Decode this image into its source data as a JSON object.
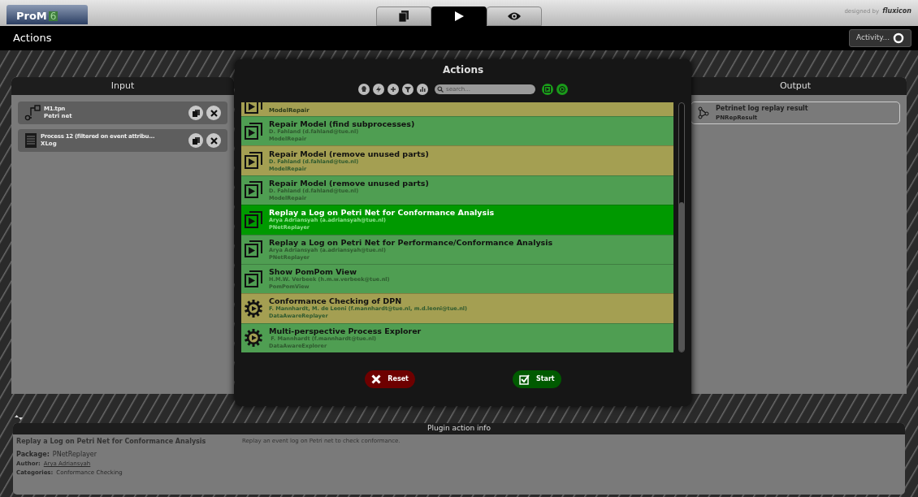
{
  "top_bar": {
    "logo": {
      "name": "ProM",
      "version": "6"
    },
    "tabs": [
      {
        "kind": "workspace",
        "selected": false
      },
      {
        "kind": "actions",
        "selected": true
      },
      {
        "kind": "views",
        "selected": false
      }
    ],
    "credit": {
      "prefix": "designed by",
      "brand": "fluxicon"
    }
  },
  "header": {
    "title": "Actions",
    "activity_button": "Activity..."
  },
  "input": {
    "title": "Input",
    "items": [
      {
        "kind": "petrinet",
        "name": "M1.tpn",
        "type": "Petri net"
      },
      {
        "kind": "log",
        "name": "Process 12 (filtered on event attribu...",
        "type": "XLog"
      }
    ]
  },
  "output": {
    "title": "Output",
    "items": [
      {
        "name": "Petrinet log replay result",
        "type": "PNRepResult"
      }
    ]
  },
  "dialog": {
    "title": "Actions",
    "search": {
      "placeholder": "search..."
    },
    "partial_row": {
      "kind": "plugin",
      "package": "ModelRepair",
      "color": "#a49f52"
    },
    "rows": [
      {
        "kind": "plugin",
        "title": "Repair Model (find subprocesses)",
        "author": "D. Fahland (d.fahland@tue.nl)",
        "package": "ModelRepair",
        "color": "#4f9e52",
        "selected": false
      },
      {
        "kind": "plugin",
        "title": "Repair Model (remove unused parts)",
        "author": "D. Fahland (d.fahland@tue.nl)",
        "package": "ModelRepair",
        "color": "#a49f52",
        "selected": false
      },
      {
        "kind": "plugin",
        "title": "Repair Model (remove unused parts)",
        "author": "D. Fahland (d.fahland@tue.nl)",
        "package": "ModelRepair",
        "color": "#4f9e52",
        "selected": false
      },
      {
        "kind": "plugin",
        "title": "Replay a Log on Petri Net for Conformance Analysis",
        "author": "Arya Adriansyah (a.adriansyah@tue.nl)",
        "package": "PNetReplayer",
        "selected": true
      },
      {
        "kind": "plugin",
        "title": "Replay a Log on Petri Net for Performance/Conformance Analysis",
        "author": "Arya Adriansyah (a.adriansyah@tue.nl)",
        "package": "PNetReplayer",
        "color": "#4f9e52",
        "selected": false
      },
      {
        "kind": "plugin",
        "title": "Show PomPom View",
        "author": "H.M.W. Verbeek (h.m.w.verbeek@tue.nl)",
        "package": "PomPomView",
        "color": "#4f9e52",
        "selected": false
      },
      {
        "kind": "gear",
        "title": "Conformance Checking of DPN",
        "author": "F. Mannhardt, M. de Leoni (f.mannhardt@tue.nl, m.d.leoni@tue.nl)",
        "package": "DataAwareReplayer",
        "color": "#a49f52",
        "selected": false
      },
      {
        "kind": "gear",
        "title": "Multi-perspective Process Explorer",
        "author": " F. Mannhardt (f.mannhardt@tue.nl)",
        "package": "DataAwareExplorer",
        "color": "#4f9e52",
        "selected": false
      }
    ],
    "reset_button": "Reset",
    "start_button": "Start"
  },
  "info": {
    "title": "Plugin action info",
    "plugin_name": "Replay a Log on Petri Net for Conformance Analysis",
    "description": "Replay an event log on Petri net to check conformance.",
    "package_label": "Package:",
    "package": "PNetReplayer",
    "author_label": "Author:",
    "author": "Arya Adriansyah",
    "categories_label": "Categories:",
    "categories": "Conformance Checking"
  }
}
